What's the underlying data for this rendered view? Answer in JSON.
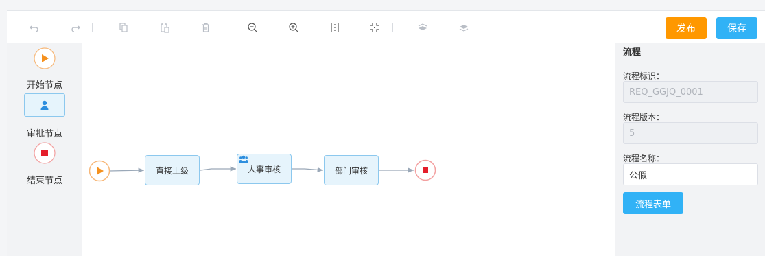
{
  "toolbar": {
    "icons": [
      "undo-icon",
      "redo-icon",
      "copy-icon",
      "paste-icon",
      "delete-icon",
      "zoom-out-icon",
      "zoom-in-icon",
      "fit-width-icon",
      "fit-actual-icon",
      "send-back-icon",
      "bring-front-icon"
    ],
    "publish_label": "发布",
    "save_label": "保存",
    "publish_color": "#ff9800",
    "save_color": "#31b2f6"
  },
  "palette": {
    "start_label": "开始节点",
    "approve_label": "审批节点",
    "end_label": "结束节点"
  },
  "canvas": {
    "nodes": [
      {
        "label": "直接上级"
      },
      {
        "label": "人事审核"
      },
      {
        "label": "部门审核"
      }
    ]
  },
  "panel": {
    "title": "流程",
    "id_label": "流程标识：",
    "id_value": "REQ_GGJQ_0001",
    "version_label": "流程版本：",
    "version_value": "5",
    "name_label": "流程名称：",
    "name_value": "公假",
    "form_button": "流程表单"
  }
}
